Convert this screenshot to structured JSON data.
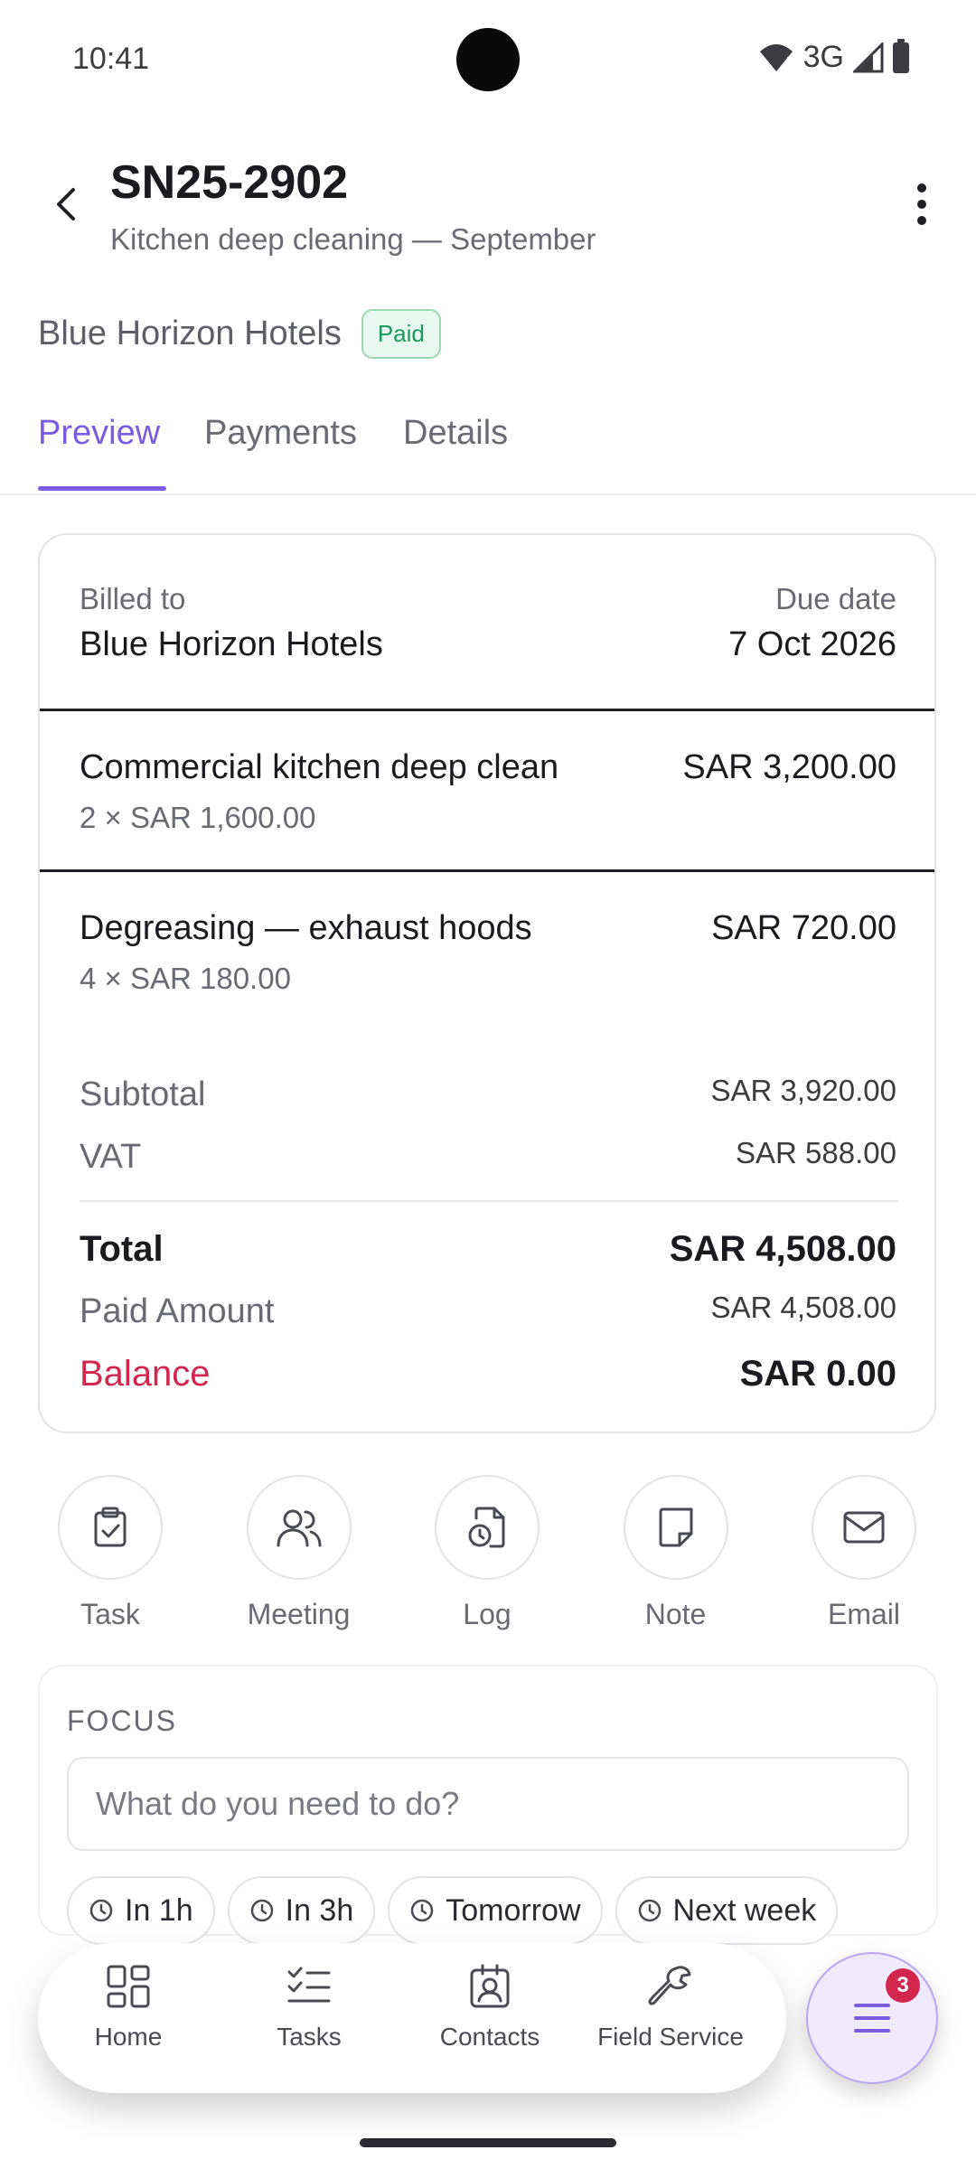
{
  "status": {
    "time": "10:41",
    "network": "3G"
  },
  "header": {
    "title": "SN25-2902",
    "subtitle": "Kitchen deep cleaning — September",
    "client": "Blue Horizon Hotels",
    "status_badge": "Paid"
  },
  "tabs": [
    {
      "label": "Preview",
      "active": true
    },
    {
      "label": "Payments",
      "active": false
    },
    {
      "label": "Details",
      "active": false
    }
  ],
  "invoice": {
    "billed_to_label": "Billed to",
    "billed_to": "Blue Horizon Hotels",
    "due_date_label": "Due date",
    "due_date": "7 Oct 2026",
    "lines": [
      {
        "title": "Commercial kitchen deep clean",
        "qty": "2 × SAR 1,600.00",
        "amount": "SAR 3,200.00"
      },
      {
        "title": "Degreasing — exhaust hoods",
        "qty": "4 × SAR 180.00",
        "amount": "SAR 720.00"
      }
    ],
    "subtotal_label": "Subtotal",
    "subtotal": "SAR 3,920.00",
    "vat_label": "VAT",
    "vat": "SAR 588.00",
    "total_label": "Total",
    "total": "SAR 4,508.00",
    "paid_label": "Paid Amount",
    "paid": "SAR 4,508.00",
    "balance_label": "Balance",
    "balance": "SAR 0.00"
  },
  "actions": [
    {
      "label": "Task",
      "icon": "clipboard-check-icon"
    },
    {
      "label": "Meeting",
      "icon": "users-icon"
    },
    {
      "label": "Log",
      "icon": "clock-file-icon"
    },
    {
      "label": "Note",
      "icon": "note-icon"
    },
    {
      "label": "Email",
      "icon": "mail-icon"
    }
  ],
  "focus": {
    "title": "FOCUS",
    "placeholder": "What do you need to do?",
    "chips": [
      "In 1h",
      "In 3h",
      "Tomorrow",
      "Next week"
    ]
  },
  "nav": {
    "items": [
      {
        "label": "Home",
        "icon": "grid-icon"
      },
      {
        "label": "Tasks",
        "icon": "checklist-icon"
      },
      {
        "label": "Contacts",
        "icon": "contact-card-icon"
      },
      {
        "label": "Field Service",
        "icon": "wrench-icon"
      }
    ],
    "fab_badge": "3"
  },
  "colors": {
    "accent": "#7a5ce0",
    "paid": "#1a9a5c",
    "balance": "#d3264f"
  }
}
